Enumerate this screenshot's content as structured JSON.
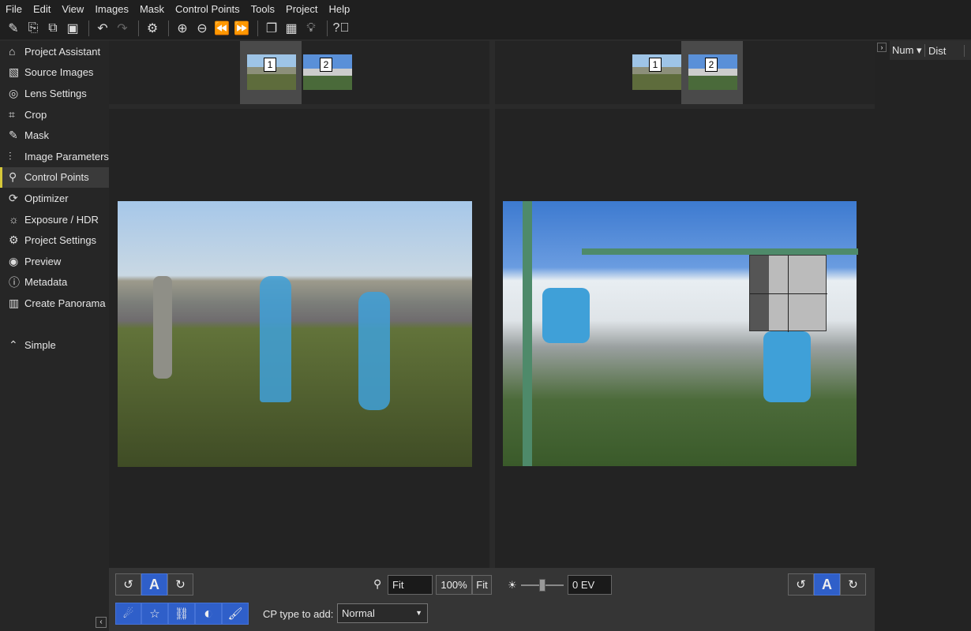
{
  "menu": [
    "File",
    "Edit",
    "View",
    "Images",
    "Mask",
    "Control Points",
    "Tools",
    "Project",
    "Help"
  ],
  "toolbar_icons": [
    "new-project-icon",
    "open-icon",
    "copy-icon",
    "save-icon",
    "undo-icon",
    "redo-icon",
    "settings-icon",
    "zoom-in-icon",
    "zoom-out-icon",
    "previous-icon",
    "next-icon",
    "stack-icon",
    "grid-icon",
    "lightbulb-icon",
    "help-icon"
  ],
  "sidebar": [
    {
      "label": "Project Assistant",
      "icon": "⌂"
    },
    {
      "label": "Source Images",
      "icon": "▧"
    },
    {
      "label": "Lens Settings",
      "icon": "◎"
    },
    {
      "label": "Crop",
      "icon": "⌗"
    },
    {
      "label": "Mask",
      "icon": "✎"
    },
    {
      "label": "Image Parameters",
      "icon": "⫶"
    },
    {
      "label": "Control Points",
      "icon": "⚲",
      "active": true
    },
    {
      "label": "Optimizer",
      "icon": "⟳"
    },
    {
      "label": "Exposure / HDR",
      "icon": "☼"
    },
    {
      "label": "Project Settings",
      "icon": "⚙"
    },
    {
      "label": "Preview",
      "icon": "◉"
    },
    {
      "label": "Metadata",
      "icon": "ⓘ"
    },
    {
      "label": "Create Panorama",
      "icon": "▥"
    }
  ],
  "simple": {
    "label": "Simple",
    "icon": "⌃"
  },
  "left_thumbs": [
    "1",
    "2"
  ],
  "right_thumbs": [
    "1",
    "2"
  ],
  "zoom": {
    "value": "Fit",
    "pct": "100%",
    "fit": "Fit"
  },
  "exposure": {
    "value": "0 EV",
    "slider": 0.5
  },
  "cp_type": {
    "label": "CP type to add:",
    "value": "Normal"
  },
  "auto_label": "A",
  "table": {
    "columns": [
      "Num ▾",
      "Dist"
    ]
  },
  "colors": {
    "accent": "#2f5fc9",
    "active_marker": "#d6c83a"
  }
}
